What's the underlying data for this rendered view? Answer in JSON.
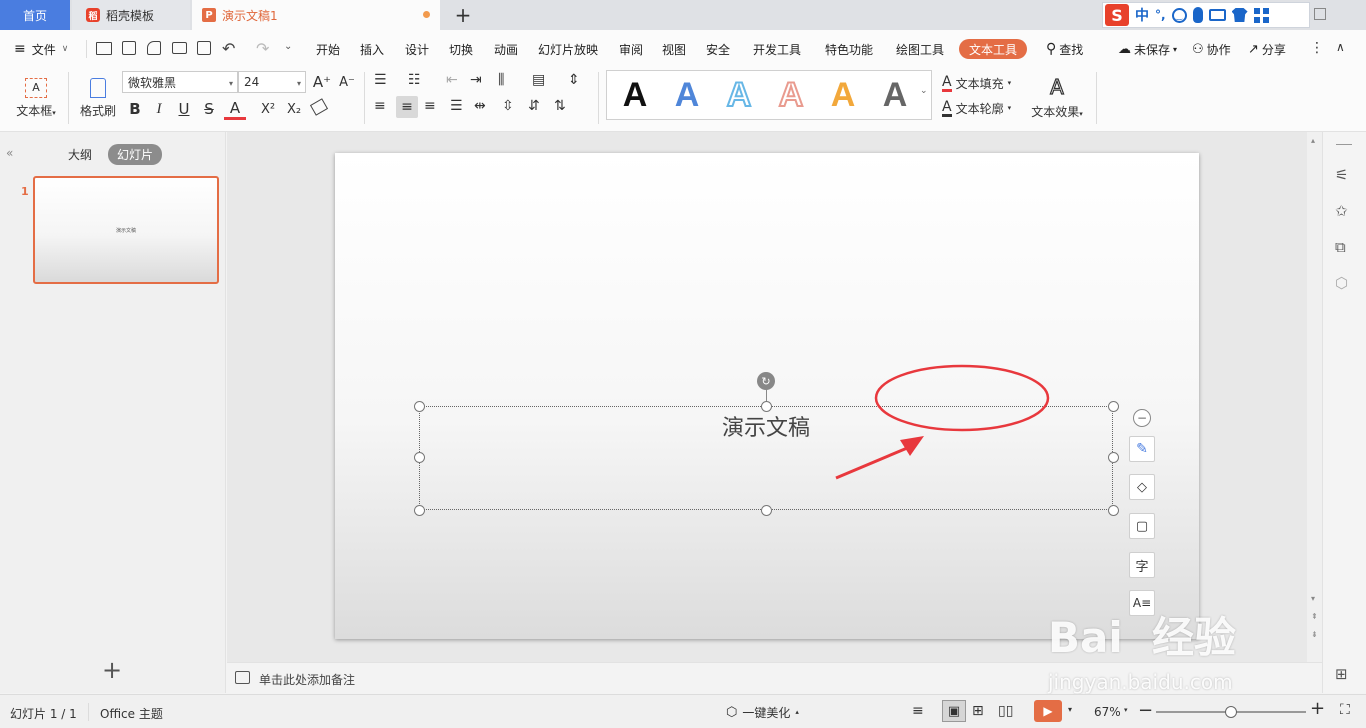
{
  "tabs": {
    "home": "首页",
    "template": "稻壳模板",
    "document": "演示文稿1",
    "add": "+"
  },
  "ime": {
    "mode": "中",
    "punct": "°,"
  },
  "menu": {
    "file": "文件",
    "items": [
      "开始",
      "插入",
      "设计",
      "切换",
      "动画",
      "幻灯片放映",
      "审阅",
      "视图",
      "安全",
      "开发工具",
      "特色功能",
      "绘图工具"
    ],
    "active": "文本工具",
    "search": "查找",
    "unsaved": "未保存",
    "collab": "协作",
    "share": "分享"
  },
  "ribbon": {
    "textbox": "文本框",
    "format_painter": "格式刷",
    "font_name": "微软雅黑",
    "font_size": "24",
    "grow": "A⁺",
    "shrink": "A⁻",
    "bold": "B",
    "italic": "I",
    "underline": "U",
    "strike": "S",
    "fontcolor": "A",
    "superscript": "X²",
    "subscript": "X₂",
    "wordart_letter": "A",
    "wordart_colors": [
      "#111111",
      "#4f86d9",
      "#67b7e6",
      "#e99b8f",
      "#f2a83b",
      "#666666"
    ],
    "text_fill": "文本填充",
    "text_outline": "文本轮廓",
    "text_effect": "文本效果"
  },
  "left_panel": {
    "outline": "大纲",
    "slides": "幻灯片",
    "slide_number": "1",
    "thumb_title": "演示文稿",
    "add": "+"
  },
  "slide": {
    "title": "演示文稿"
  },
  "notes": {
    "placeholder": "单击此处添加备注"
  },
  "status": {
    "slide_count": "幻灯片 1 / 1",
    "theme": "Office 主题",
    "beautify": "一键美化",
    "zoom": "67%",
    "zoom_fraction": 0.5
  },
  "watermark": {
    "brand": "Bai  经验",
    "url": "jingyan.baidu.com"
  },
  "colors": {
    "accent": "#e46d45",
    "home_tab": "#4a7de0",
    "annotation": "#e8383d"
  }
}
